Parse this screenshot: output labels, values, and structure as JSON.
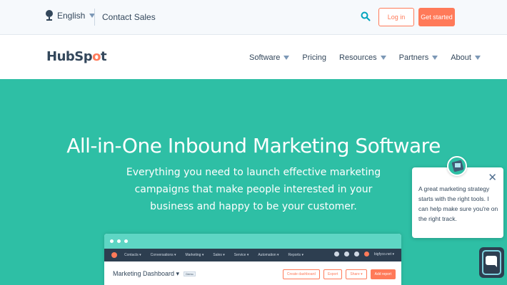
{
  "utility_bar": {
    "language": "English",
    "contact": "Contact Sales",
    "login": "Log in",
    "get_started": "Get started"
  },
  "nav": {
    "logo": "HubSpot",
    "items": [
      {
        "label": "Software",
        "has_dropdown": true
      },
      {
        "label": "Pricing",
        "has_dropdown": false
      },
      {
        "label": "Resources",
        "has_dropdown": true
      },
      {
        "label": "Partners",
        "has_dropdown": true
      },
      {
        "label": "About",
        "has_dropdown": true
      }
    ]
  },
  "hero": {
    "title": "All-in-One Inbound Marketing Software",
    "subtitle": "Everything you need to launch effective marketing campaigns that make people interested in your business and happy to be your customer."
  },
  "preview": {
    "menu": [
      "Contacts ▾",
      "Conversations ▾",
      "Marketing ▾",
      "Sales ▾",
      "Service ▾",
      "Automation ▾",
      "Reports ▾"
    ],
    "account": "bigfyco.net ▾",
    "title": "Marketing Dashboard ▾",
    "badge": "Demo",
    "buttons": [
      "Create dashboard",
      "Export",
      "Share ▾",
      "Add report"
    ]
  },
  "chat": {
    "message": "A great marketing strategy starts with the right tools. I can help make sure you're on the right track."
  },
  "colors": {
    "accent": "#ff7a59",
    "hero_bg": "#2ebfa5",
    "text": "#33475b"
  }
}
